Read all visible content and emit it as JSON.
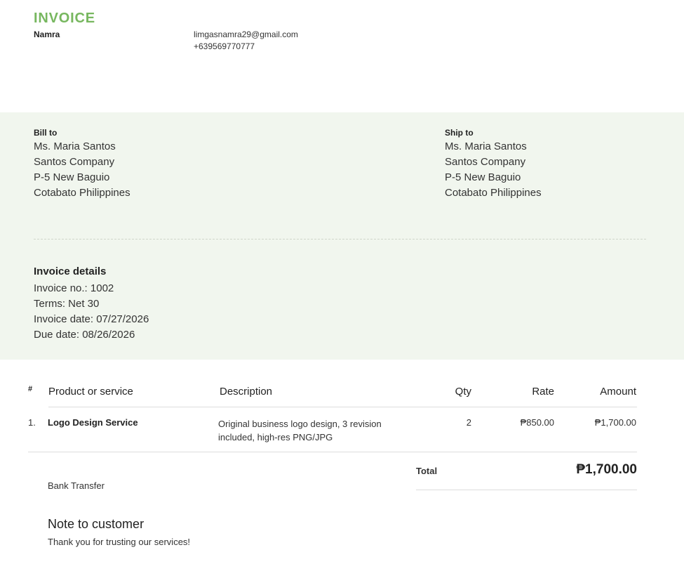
{
  "header": {
    "title": "INVOICE",
    "company": "Namra",
    "email": "limgasnamra29@gmail.com",
    "phone": "+639569770777"
  },
  "bill_to": {
    "label": "Bill to",
    "lines": [
      "Ms. Maria Santos",
      "Santos Company",
      "P-5 New Baguio",
      "Cotabato Philippines"
    ]
  },
  "ship_to": {
    "label": "Ship to",
    "lines": [
      "Ms. Maria Santos",
      "Santos Company",
      "P-5 New Baguio",
      "Cotabato Philippines"
    ]
  },
  "details": {
    "title": "Invoice details",
    "lines": [
      "Invoice no.: 1002",
      "Terms: Net 30",
      "Invoice date: 07/27/2026",
      "Due date: 08/26/2026"
    ]
  },
  "table": {
    "headers": {
      "num": "#",
      "product": "Product or service",
      "description": "Description",
      "qty": "Qty",
      "rate": "Rate",
      "amount": "Amount"
    },
    "rows": [
      {
        "num": "1.",
        "product": "Logo Design Service",
        "description": "Original business logo design, 3 revision included, high-res PNG/JPG",
        "qty": "2",
        "rate": "₱850.00",
        "amount": "₱1,700.00"
      }
    ]
  },
  "totals": {
    "label": "Total",
    "value": "₱1,700.00"
  },
  "payment_method": "Bank Transfer",
  "note": {
    "title": "Note to customer",
    "body": "Thank you for trusting our services!"
  },
  "colors": {
    "accent": "#77b75f",
    "band": "#f1f6ee"
  }
}
